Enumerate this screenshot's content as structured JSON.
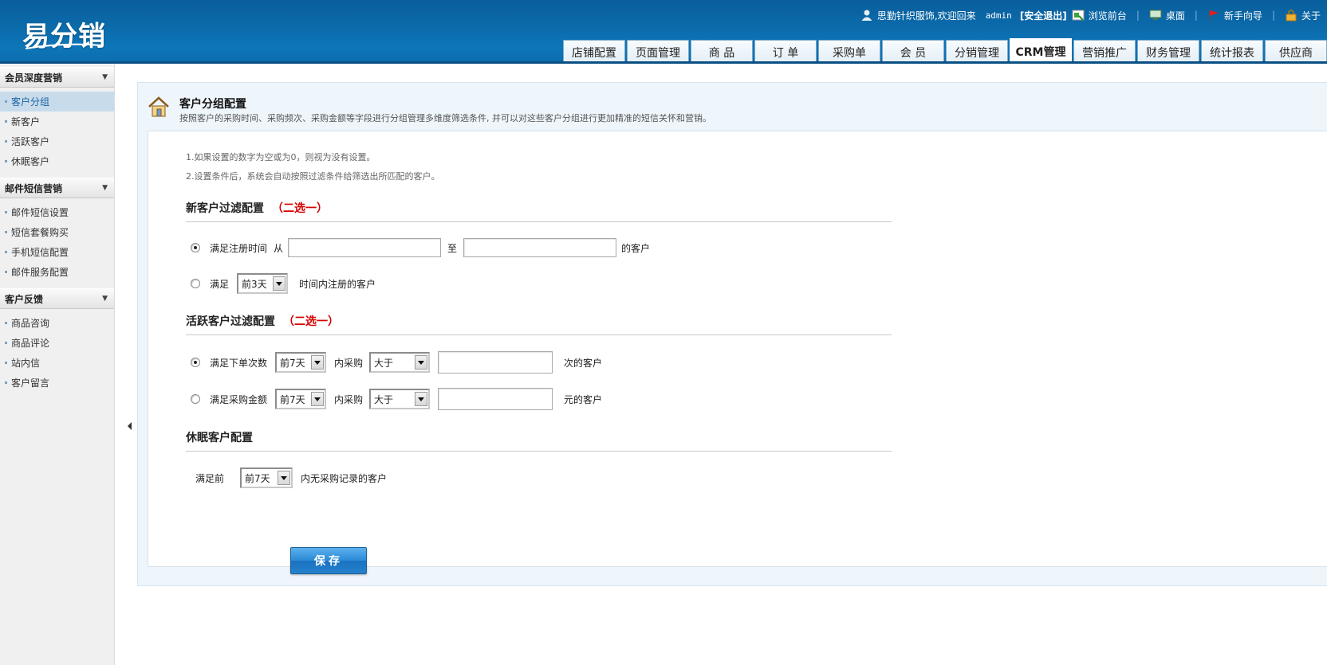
{
  "header": {
    "logo_text": "易分销",
    "welcome": "思勤针织服饰,欢迎回来",
    "username": "admin",
    "logout": "[安全退出]",
    "links": [
      "浏览前台",
      "桌面",
      "新手向导",
      "关于"
    ],
    "tabs": [
      "店铺配置",
      "页面管理",
      "商 品",
      "订 单",
      "采购单",
      "会 员",
      "分销管理",
      "CRM管理",
      "营销推广",
      "财务管理",
      "统计报表",
      "供应商"
    ],
    "active_tab": "CRM管理"
  },
  "sidebar": {
    "groups": [
      {
        "title": "会员深度营销",
        "items": [
          "客户分组",
          "新客户",
          "活跃客户",
          "休眠客户"
        ]
      },
      {
        "title": "邮件短信营销",
        "items": [
          "邮件短信设置",
          "短信套餐购买",
          "手机短信配置",
          "邮件服务配置"
        ]
      },
      {
        "title": "客户反馈",
        "items": [
          "商品咨询",
          "商品评论",
          "站内信",
          "客户留言"
        ]
      }
    ],
    "active_item": "客户分组"
  },
  "page": {
    "title": "客户分组配置",
    "description": "按照客户的采购时间、采购频次、采购金额等字段进行分组管理多维度筛选条件, 并可以对这些客户分组进行更加精准的短信关怀和营销。",
    "notes": [
      "1.如果设置的数字为空或为0，则视为没有设置。",
      "2.设置条件后，系统会自动按照过滤条件给筛选出所匹配的客户。"
    ]
  },
  "new_customer": {
    "title": "新客户过滤配置",
    "hint": "（二选一）",
    "opt1_label": "满足注册时间",
    "opt1_from": "从",
    "opt1_from_value": "",
    "opt1_to": "至",
    "opt1_to_value": "",
    "opt1_suffix": "的客户",
    "opt2_label": "满足",
    "opt2_select": "前3天",
    "opt2_suffix": "时间内注册的客户"
  },
  "active_customer": {
    "title": "活跃客户过滤配置",
    "hint": "（二选一）",
    "opt1_label": "满足下单次数",
    "opt1_period": "前7天",
    "opt1_mid": "内采购",
    "opt1_compare": "大于",
    "opt1_value": "",
    "opt1_suffix": "次的客户",
    "opt2_label": "满足采购金额",
    "opt2_period": "前7天",
    "opt2_mid": "内采购",
    "opt2_compare": "大于",
    "opt2_value": "",
    "opt2_suffix": "元的客户"
  },
  "dormant_customer": {
    "title": "休眠客户配置",
    "label": "满足前",
    "period": "前7天",
    "suffix": "内无采购记录的客户"
  },
  "save_label": "保存",
  "colors": {
    "header_blue": "#0b6aaa",
    "accent_red": "#d40000",
    "active_sidebar": "#c7dbeb",
    "save_button": "#2a89d6"
  }
}
